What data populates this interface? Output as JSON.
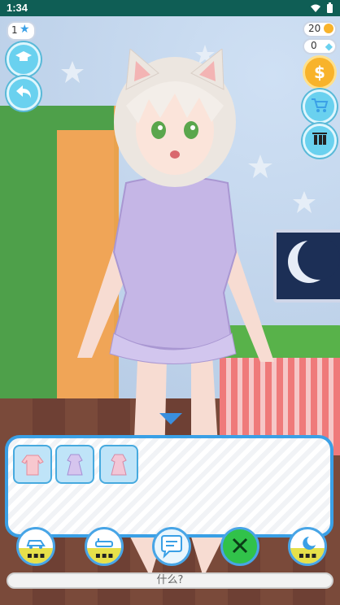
{
  "status_bar": {
    "time": "1:34",
    "icons": [
      "wifi-icon",
      "battery-icon"
    ]
  },
  "hud": {
    "level": "1",
    "coins": "20",
    "gems": "0",
    "shop_symbol": "$"
  },
  "wardrobe_items": [
    {
      "name": "pink-jacket"
    },
    {
      "name": "purple-dress"
    },
    {
      "name": "pink-dress"
    }
  ],
  "dock": {
    "buttons": [
      "car-icon",
      "bath-icon",
      "chat-icon",
      "food-icon",
      "sleep-icon"
    ],
    "chat_symbol": "···"
  },
  "input": {
    "placeholder": "什么?"
  },
  "colors": {
    "accent": "#3aa0e6",
    "teal": "#0f5e55",
    "gold": "#f8b32b"
  }
}
